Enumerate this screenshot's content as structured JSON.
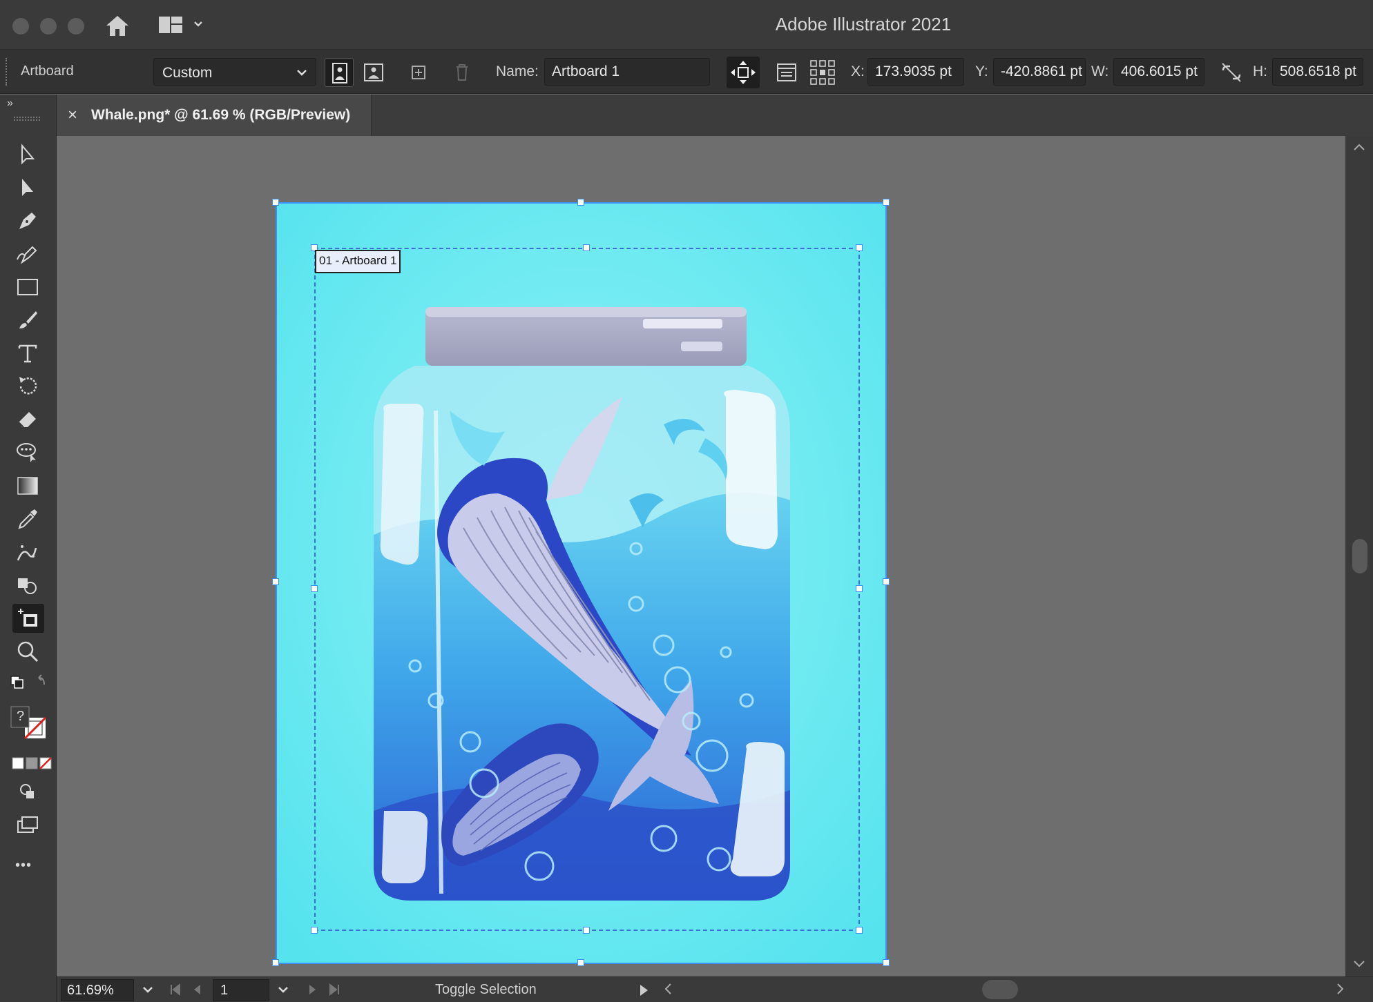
{
  "window": {
    "title": "Adobe Illustrator 2021"
  },
  "control_bar": {
    "mode_label": "Artboard",
    "preset": "Custom",
    "name_label": "Name:",
    "name_value": "Artboard 1",
    "x_label": "X:",
    "x_value": "173.9035 pt",
    "y_label": "Y:",
    "y_value": "-420.8861 pt",
    "w_label": "W:",
    "w_value": "406.6015 pt",
    "h_label": "H:",
    "h_value": "508.6518 pt"
  },
  "document_tab": {
    "close_glyph": "×",
    "title": "Whale.png* @ 61.69 % (RGB/Preview)"
  },
  "toolbar": {
    "collapse_glyph": "»",
    "tools": [
      "selection-tool",
      "direct-selection-tool",
      "pen-tool",
      "curvature-tool",
      "rectangle-tool",
      "paintbrush-tool",
      "type-tool",
      "rotate-tool",
      "eraser-tool",
      "puppet-warp-tool",
      "gradient-tool",
      "eyedropper-tool",
      "symbol-sprayer-tool",
      "shape-builder-tool",
      "artboard-tool",
      "zoom-tool"
    ],
    "active_tool": "artboard-tool",
    "more_glyph": "•••",
    "fill_question": "?"
  },
  "canvas": {
    "artboard_label": "01 - Artboard 1",
    "artwork": "whale-in-jar-illustration"
  },
  "status_bar": {
    "zoom": "61.69%",
    "page": "1",
    "info": "Toggle Selection"
  },
  "colors": {
    "selection_blue": "#3d8ef7",
    "artboard_cyan": "#5ce6f0",
    "ui_dark": "#3a3a3a"
  }
}
